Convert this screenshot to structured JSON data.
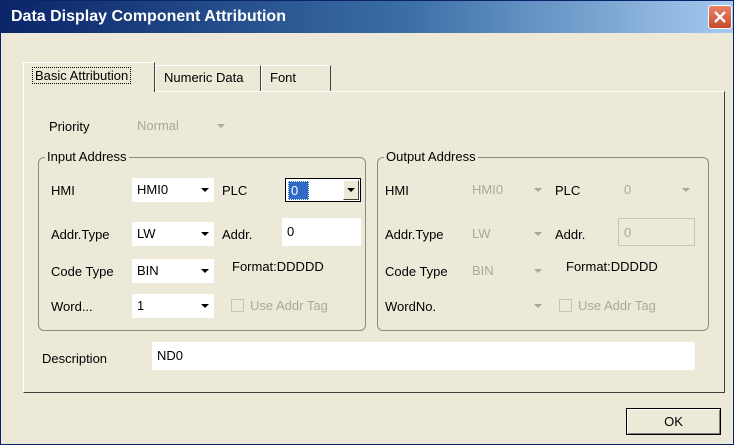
{
  "window": {
    "title": "Data Display Component Attribution",
    "close_icon": "close-icon",
    "colors": {
      "titlebar_start": "#0a246a",
      "titlebar_end": "#a6caf0",
      "face": "#ece9d8",
      "close": "#c94a2a"
    }
  },
  "tabs": [
    {
      "label": "Basic Attribution",
      "active": true
    },
    {
      "label": "Numeric Data",
      "active": false
    },
    {
      "label": "Font",
      "active": false
    }
  ],
  "priority": {
    "label": "Priority",
    "value": "Normal",
    "enabled": false
  },
  "input_address": {
    "title": "Input Address",
    "hmi_label": "HMI",
    "hmi_value": "HMI0",
    "plc_label": "PLC",
    "plc_value": "0",
    "addr_type_label": "Addr.Type",
    "addr_type_value": "LW",
    "addr_label": "Addr.",
    "addr_value": "0",
    "code_type_label": "Code Type",
    "code_type_value": "BIN",
    "format_label": "Format:DDDDD",
    "word_label": "Word...",
    "word_value": "1",
    "use_addr_tag_label": "Use Addr Tag"
  },
  "output_address": {
    "title": "Output Address",
    "hmi_label": "HMI",
    "hmi_value": "HMI0",
    "plc_label": "PLC",
    "plc_value": "0",
    "addr_type_label": "Addr.Type",
    "addr_type_value": "LW",
    "addr_label": "Addr.",
    "addr_value": "0",
    "code_type_label": "Code Type",
    "code_type_value": "BIN",
    "format_label": "Format:DDDDD",
    "word_label": "WordNo.",
    "word_value": "",
    "use_addr_tag_label": "Use Addr Tag"
  },
  "description": {
    "label": "Description",
    "value": "ND0"
  },
  "ok_label": "OK"
}
